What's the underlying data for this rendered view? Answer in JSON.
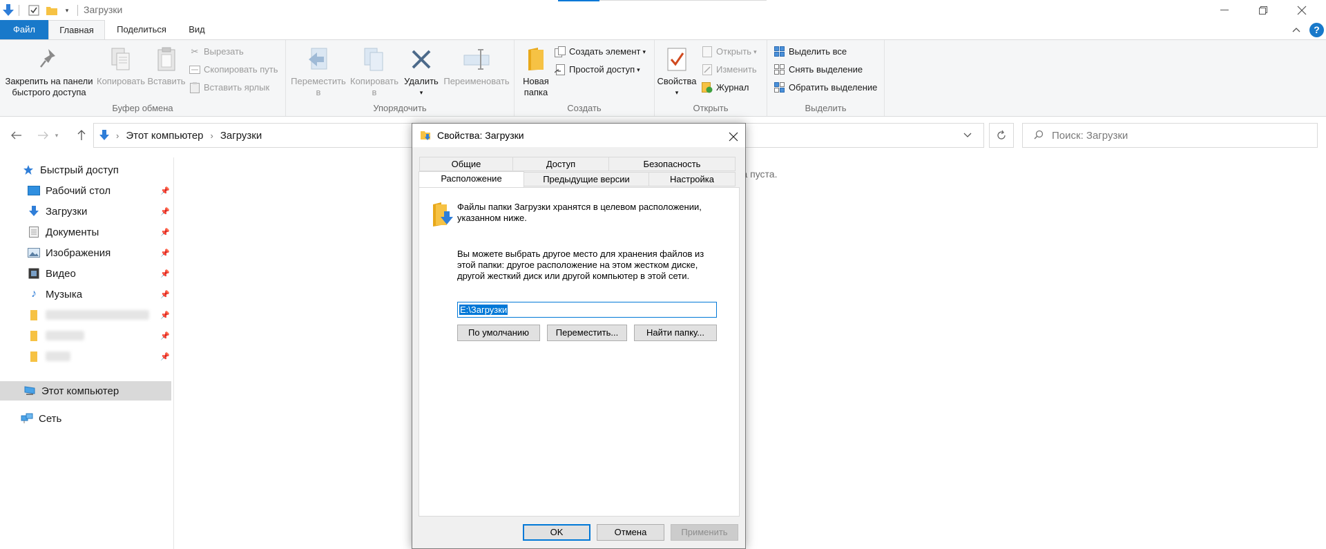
{
  "window": {
    "title": "Загрузки"
  },
  "ribbon_tabs": {
    "file": "Файл",
    "home": "Главная",
    "share": "Поделиться",
    "view": "Вид"
  },
  "ribbon": {
    "clipboard": {
      "title": "Буфер обмена",
      "pin": "Закрепить на панели быстрого доступа",
      "copy": "Копировать",
      "paste": "Вставить",
      "cut": "Вырезать",
      "copy_path": "Скопировать путь",
      "paste_shortcut": "Вставить ярлык"
    },
    "organize": {
      "title": "Упорядочить",
      "move_to": "Переместить в",
      "copy_to": "Копировать в",
      "delete": "Удалить",
      "rename": "Переименовать"
    },
    "create": {
      "title": "Создать",
      "new_folder": "Новая папка",
      "new_item": "Создать элемент",
      "easy_access": "Простой доступ"
    },
    "open": {
      "title": "Открыть",
      "properties": "Свойства",
      "open": "Открыть",
      "edit": "Изменить",
      "history": "Журнал"
    },
    "select": {
      "title": "Выделить",
      "select_all": "Выделить все",
      "select_none": "Снять выделение",
      "invert": "Обратить выделение"
    }
  },
  "address": {
    "crumbs": [
      "Этот компьютер",
      "Загрузки"
    ],
    "search_placeholder": "Поиск: Загрузки"
  },
  "nav": {
    "quick_access": "Быстрый доступ",
    "desktop": "Рабочий стол",
    "downloads": "Загрузки",
    "documents": "Документы",
    "pictures": "Изображения",
    "video": "Видео",
    "music": "Музыка",
    "this_pc": "Этот компьютер",
    "network": "Сеть"
  },
  "content": {
    "empty_text": "ка пуста."
  },
  "dialog": {
    "title": "Свойства: Загрузки",
    "tabs_row1": [
      "Общие",
      "Доступ",
      "Безопасность"
    ],
    "tabs_row2": [
      "Расположение",
      "Предыдущие версии",
      "Настройка"
    ],
    "desc1": "Файлы папки Загрузки хранятся в целевом расположении, указанном ниже.",
    "desc2": "Вы можете выбрать другое место для хранения файлов из этой папки: другое расположение на этом жестком диске, другой жесткий диск или другой компьютер в этой сети.",
    "path_value": "E:\\Загрузки",
    "btn_default": "По умолчанию",
    "btn_move": "Переместить...",
    "btn_find": "Найти папку...",
    "btn_ok": "OK",
    "btn_cancel": "Отмена",
    "btn_apply": "Применить"
  },
  "colors": {
    "accent": "#0078d7",
    "file_tab": "#1979ca",
    "folder": "#f6c244"
  }
}
